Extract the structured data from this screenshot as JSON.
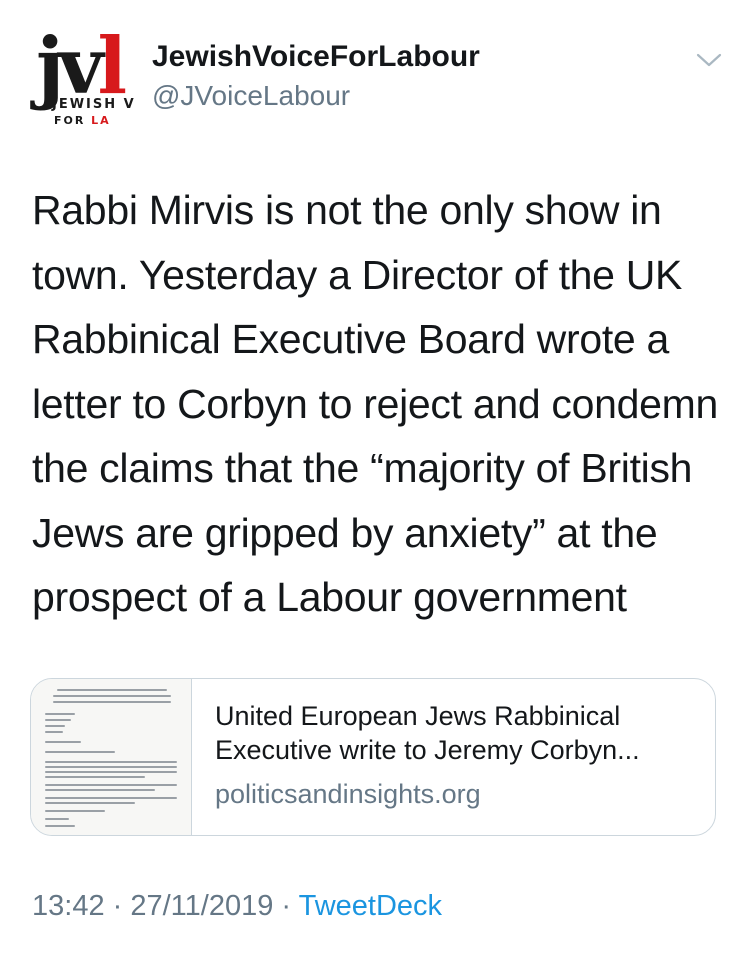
{
  "author": {
    "display_name": "JewishVoiceForLabour",
    "handle": "@JVoiceLabour",
    "avatar": {
      "logo_letters_dark": "jv",
      "logo_letter_red": "l",
      "word_line1": "JEWISH V",
      "word_line2_dark": "FOR ",
      "word_line2_red": "LA",
      "brand_red": "#d7191c"
    }
  },
  "menu_icon": "chevron-down-icon",
  "tweet": {
    "text": "Rabbi Mirvis is not the only show in town. Yesterday a Director of the UK Rabbinical Executive Board wrote a letter to Corbyn to reject and condemn the claims that the “majority of British Jews are gripped by anxiety” at the prospect of a Labour government",
    "lines": [
      "Rabbi Mirvis is not the only show in",
      "town. Yesterday a Director of the UK",
      "Rabbinical Executive Board wrote a",
      "letter to Corbyn to reject and condemn",
      "the claims that the “majority of British",
      "Jews are gripped by anxiety” at the",
      "prospect of a Labour government"
    ]
  },
  "card": {
    "title_line1": "United European Jews Rabbinical",
    "title_line2": "Executive write to Jeremy Corbyn...",
    "domain": "politicsandinsights.org",
    "thumbnail": "letter-document-thumbnail"
  },
  "footer": {
    "time": "13:42",
    "separator": " · ",
    "date": "27/11/2019",
    "source": "TweetDeck"
  },
  "colors": {
    "text": "#14171a",
    "secondary": "#657786",
    "link": "#1b95e0",
    "border": "#ccd6dd"
  }
}
